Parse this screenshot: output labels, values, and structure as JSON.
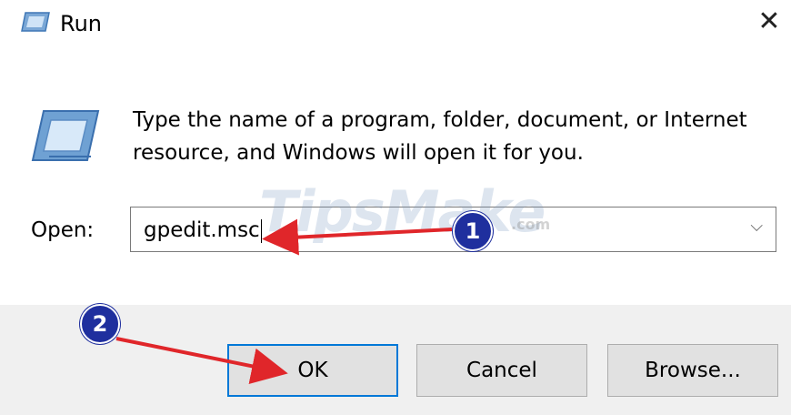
{
  "window": {
    "title": "Run",
    "close_glyph": "✕"
  },
  "message": {
    "text": "Type the name of a program, folder, document, or Internet resource, and Windows will open it for you."
  },
  "open_field": {
    "label": "Open:",
    "value": "gpedit.msc",
    "dropdown_glyph": "⌵"
  },
  "buttons": {
    "ok": "OK",
    "cancel": "Cancel",
    "browse": "Browse..."
  },
  "annotations": {
    "step1": "1",
    "step2": "2",
    "arrow_color": "#e0262a",
    "badge_color": "#1f2f9e"
  },
  "watermark": {
    "text": "TipsMake",
    "suffix": ".com"
  }
}
